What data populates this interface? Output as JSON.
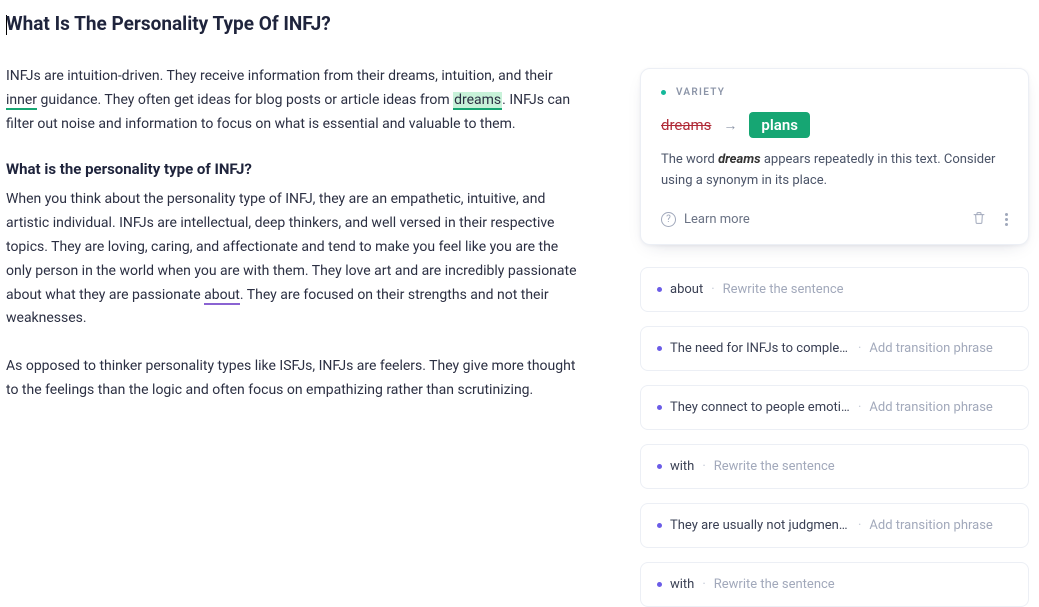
{
  "editor": {
    "title": "What Is The Personality Type Of INFJ?",
    "para1_a": "INFJs are intuition-driven. They receive information from their dreams, intuition, and their ",
    "para1_b": "inner",
    "para1_c": " guidance. They often get ideas for blog posts or article ideas from ",
    "para1_d": "dreams",
    "para1_e": ". INFJs can filter out noise and information to focus on what is essential and valuable to them.",
    "sub1": "What is the personality type of INFJ?",
    "para2_a": "When you think about the personality type of INFJ, they are an empathetic, intuitive, and artistic individual. INFJs are intellectual, deep thinkers, and well versed in their respective topics. They are loving, caring, and affectionate and tend to make you feel like you are the only person in the world when you are with them. They love art and are incredibly passionate about what they are passionate ",
    "para2_b": "about",
    "para2_c": ". They are focused on their strengths and not their weaknesses.",
    "para3": "As opposed to thinker personality types like ISFJs, INFJs are feelers. They give more thought to the feelings than the logic and often focus on empathizing rather than scrutinizing."
  },
  "card": {
    "category": "VARIETY",
    "old": "dreams",
    "new": "plans",
    "arrow": "→",
    "msg_a": "The word ",
    "msg_b": "dreams",
    "msg_c": " appears repeatedly in this text. Consider using a synonym in its place.",
    "learn": "Learn more"
  },
  "suggestions": [
    {
      "snippet": "about",
      "hint": "Rewrite the sentence"
    },
    {
      "snippet": "The need for INFJs to complete …",
      "hint": "Add transition phrase"
    },
    {
      "snippet": "They connect to people emotio…",
      "hint": "Add transition phrase"
    },
    {
      "snippet": "with",
      "hint": "Rewrite the sentence"
    },
    {
      "snippet": "They are usually not judgmental…",
      "hint": "Add transition phrase"
    },
    {
      "snippet": "with",
      "hint": "Rewrite the sentence"
    }
  ]
}
